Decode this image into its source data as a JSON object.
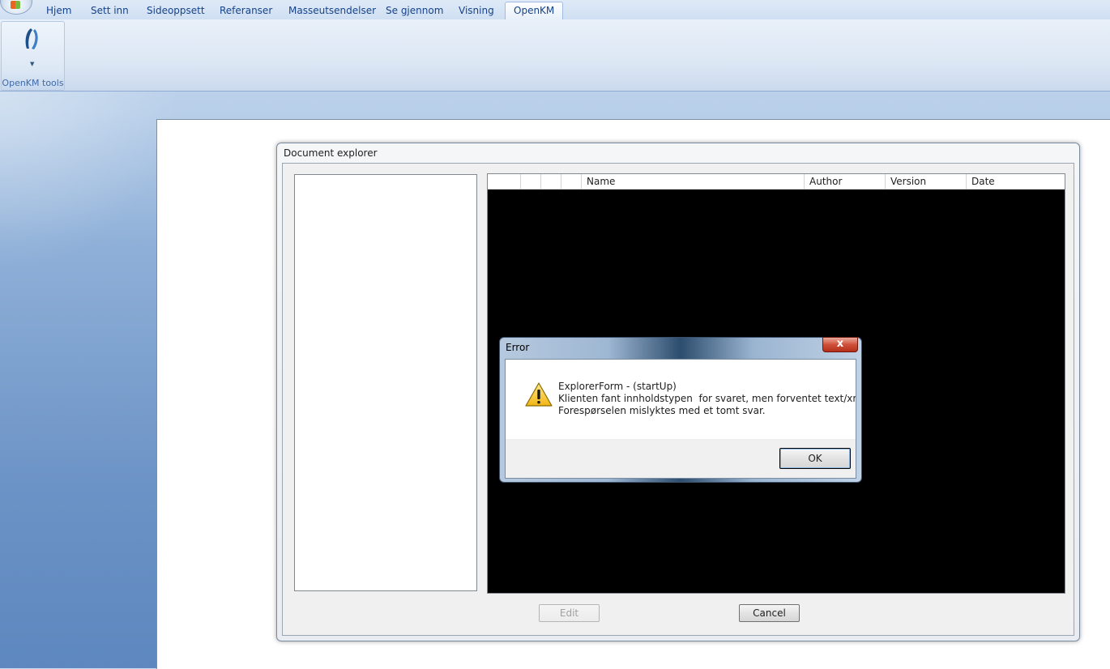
{
  "ribbon": {
    "tabs": [
      "Hjem",
      "Sett inn",
      "Sideoppsett",
      "Referanser",
      "Masseutsendelser",
      "Se gjennom",
      "Visning",
      "OpenKM"
    ],
    "active_tab": "OpenKM",
    "group_label": "OpenKM tools"
  },
  "explorer": {
    "title": "Document explorer",
    "columns": [
      "Name",
      "Author",
      "Version",
      "Date"
    ],
    "edit_label": "Edit",
    "cancel_label": "Cancel"
  },
  "error": {
    "title": "Error",
    "close_glyph": "x",
    "lines": [
      "ExplorerForm - (startUp)",
      "Klienten fant innholdstypen  for svaret, men forventet text/xml.",
      "Forespørselen mislyktes med et tomt svar."
    ],
    "ok_label": "OK"
  },
  "colors": {
    "ribbon_text": "#15428b",
    "list_background": "#000000",
    "close_button": "#c7402a"
  }
}
